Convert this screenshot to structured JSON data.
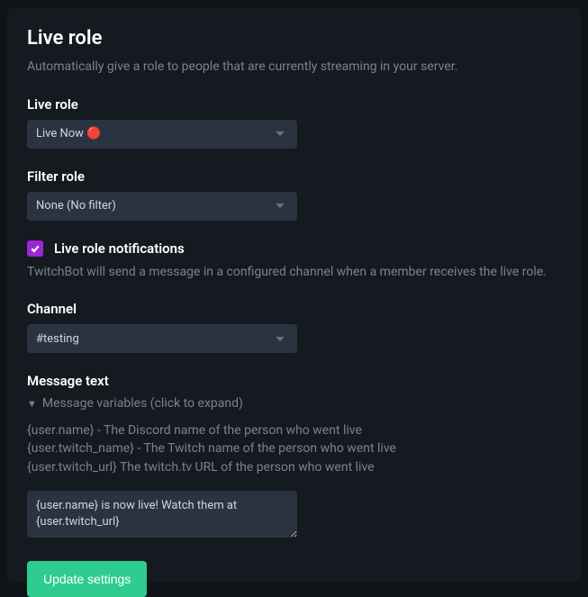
{
  "header": {
    "title": "Live role",
    "subtitle": "Automatically give a role to people that are currently streaming in your server."
  },
  "liveRole": {
    "label": "Live role",
    "value": "Live Now 🔴"
  },
  "filterRole": {
    "label": "Filter role",
    "value": "None (No filter)"
  },
  "notifications": {
    "checkbox_label": "Live role notifications",
    "checked": true,
    "help": "TwitchBot will send a message in a configured channel when a member receives the live role."
  },
  "channel": {
    "label": "Channel",
    "value": "#testing"
  },
  "messageText": {
    "label": "Message text",
    "expander": "Message variables (click to expand)",
    "variables": "{user.name} - The Discord name of the person who went live\n{user.twitch_name} - The Twitch name of the person who went live\n{user.twitch_url} The twitch.tv URL of the person who went live",
    "value": "{user.name} is now live! Watch them at {user.twitch_url}"
  },
  "submit": {
    "label": "Update settings"
  }
}
